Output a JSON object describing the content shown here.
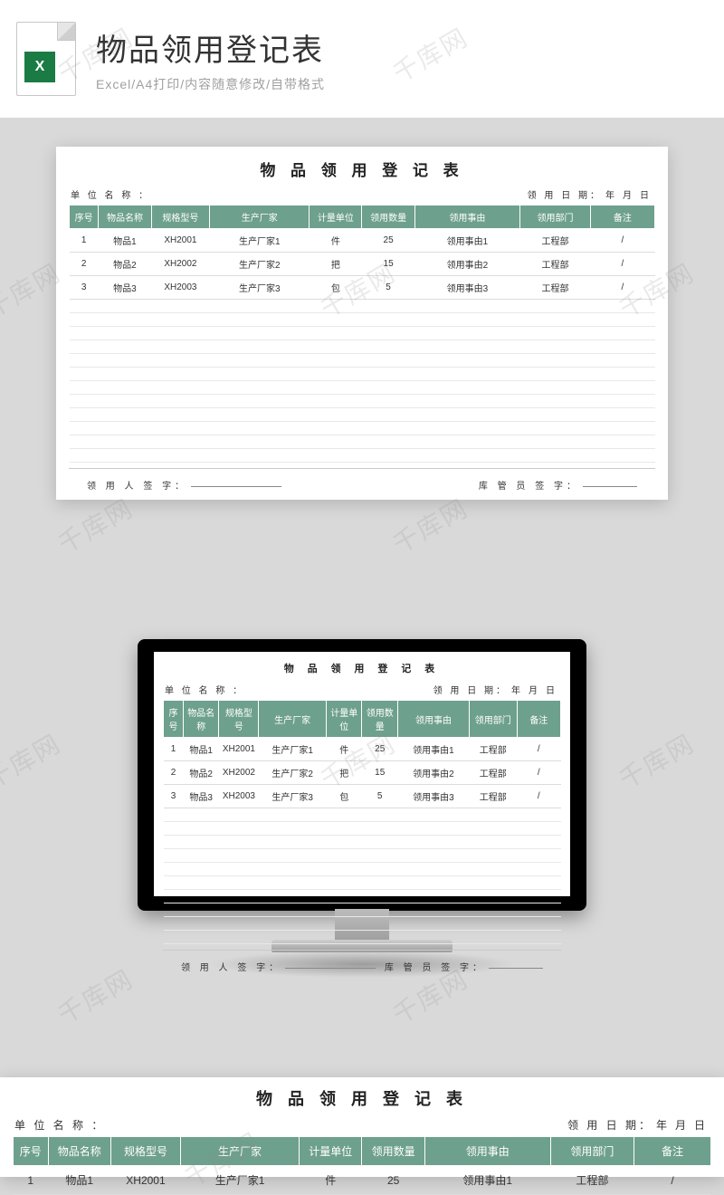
{
  "watermark": "千库网",
  "hero": {
    "icon_badge": "X",
    "title": "物品领用登记表",
    "subtitle": "Excel/A4打印/内容随意修改/自带格式"
  },
  "sheet": {
    "title": "物 品 领 用 登 记 表",
    "unit_label": "单 位 名 称 ：",
    "date_label": "领 用 日 期：",
    "date_year": "年",
    "date_month": "月",
    "date_day": "日",
    "headers": {
      "seq": "序号",
      "name": "物品名称",
      "model": "规格型号",
      "maker": "生产厂家",
      "unit": "计量单位",
      "qty": "领用数量",
      "reason": "领用事由",
      "dept": "领用部门",
      "note": "备注"
    },
    "rows": [
      {
        "seq": "1",
        "name": "物品1",
        "model": "XH2001",
        "maker": "生产厂家1",
        "unit": "件",
        "qty": "25",
        "reason": "领用事由1",
        "dept": "工程部",
        "note": "/"
      },
      {
        "seq": "2",
        "name": "物品2",
        "model": "XH2002",
        "maker": "生产厂家2",
        "unit": "把",
        "qty": "15",
        "reason": "领用事由2",
        "dept": "工程部",
        "note": "/"
      },
      {
        "seq": "3",
        "name": "物品3",
        "model": "XH2003",
        "maker": "生产厂家3",
        "unit": "包",
        "qty": "5",
        "reason": "领用事由3",
        "dept": "工程部",
        "note": "/"
      }
    ],
    "sign_receiver": "领 用 人 签 字：",
    "sign_keeper": "库 管 员 签 字：",
    "empty_rows_card1": 12,
    "empty_rows_card2": 10
  },
  "colors": {
    "header_bg": "#6ea08e",
    "page_bg": "#d9d9d9"
  }
}
